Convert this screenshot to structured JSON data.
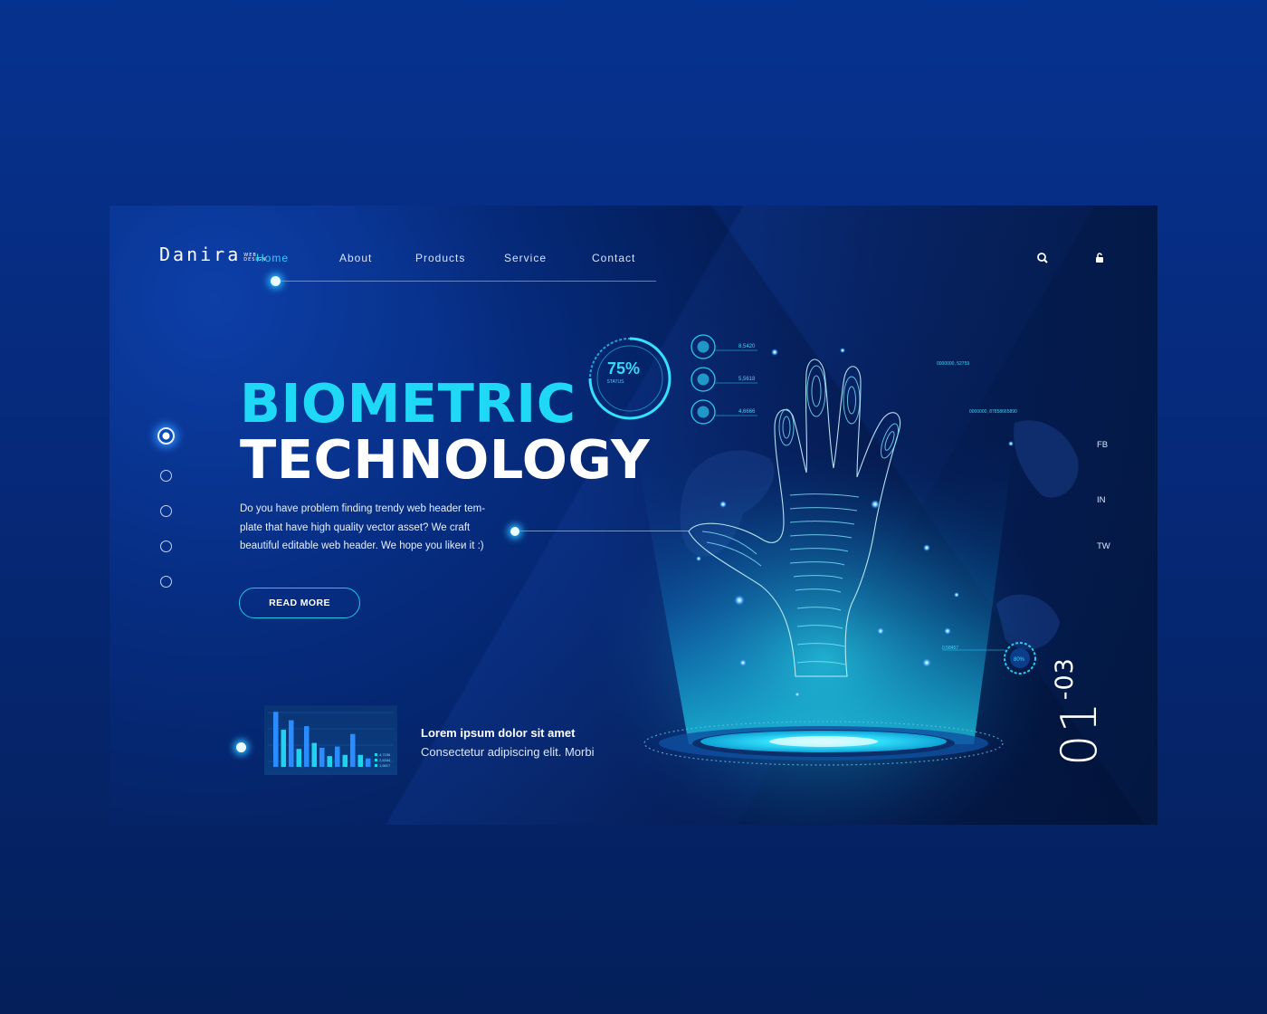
{
  "logo": {
    "word": "Danira",
    "sub_line1": "WEB",
    "sub_line2": "DESIGN"
  },
  "nav": {
    "items": [
      {
        "label": "Home",
        "active": true
      },
      {
        "label": "About",
        "active": false
      },
      {
        "label": "Products",
        "active": false
      },
      {
        "label": "Service",
        "active": false
      },
      {
        "label": "Contact",
        "active": false
      }
    ]
  },
  "header_icons": [
    "search-icon",
    "lock-icon"
  ],
  "hero": {
    "title_line1": "BIOMETRIC",
    "title_line2": "TECHNOLOGY",
    "description": "Do you have problem finding trendy web header tem- plate that have high quality vector asset? We craft beautiful editable web header. We hope you likeи it :)",
    "description_lines": [
      "Do you have problem finding trendy web header tem-",
      "plate that have high quality vector asset? We craft",
      "beautiful editable web header. We hope you likeи it :)"
    ],
    "cta_label": "READ MORE"
  },
  "feature": {
    "title": "Lorem ipsum dolor sit amet",
    "subtitle": "Consectetur adipiscing elit. Morbi"
  },
  "hud": {
    "status_percent": "75%",
    "status_label": "STATUS",
    "readouts": [
      "8,5420",
      "5,5618",
      "4,6666"
    ],
    "top_right_1": "0000000, 52759",
    "top_right_2": "0000000, 87858665890",
    "gauge_label": "0,58457",
    "gauge_percent": "80%"
  },
  "social": [
    "FB",
    "IN",
    "TW"
  ],
  "slider": {
    "current": "01",
    "separator": "-",
    "total": "03",
    "dots": 5,
    "active_index": 0
  },
  "mini_chart": {
    "legend": [
      "4,7156",
      "2,6334",
      "1,5617"
    ],
    "values": [
      0.92,
      0.62,
      0.78,
      0.3,
      0.68,
      0.4,
      0.32,
      0.18,
      0.34,
      0.2,
      0.55,
      0.2,
      0.14
    ]
  },
  "colors": {
    "accent": "#1fd8f5",
    "background": "#062d82",
    "text": "#ffffff"
  }
}
